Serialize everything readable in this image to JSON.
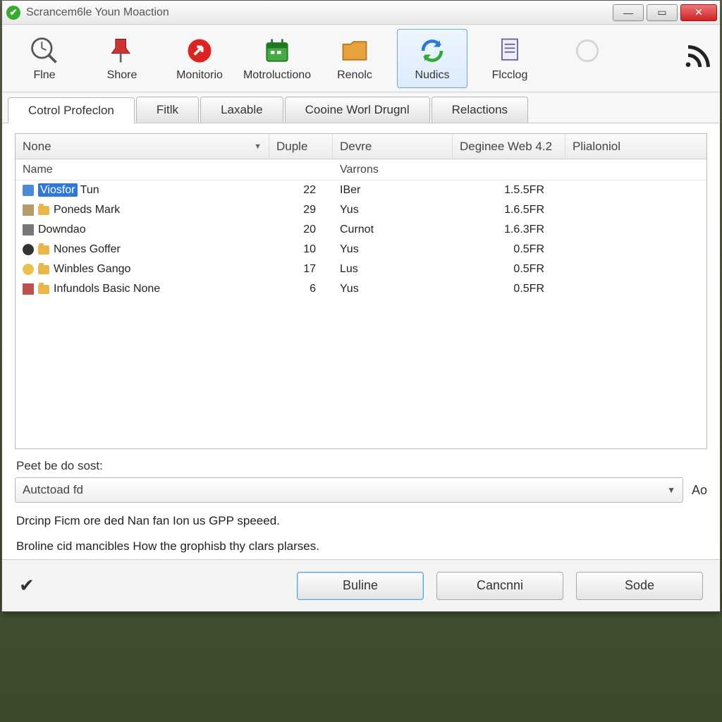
{
  "window": {
    "title": "Scrancem6le Youn Moaction"
  },
  "toolbar": {
    "items": [
      {
        "label": "Flne"
      },
      {
        "label": "Shore"
      },
      {
        "label": "Monitorio"
      },
      {
        "label": "Motroluctiono"
      },
      {
        "label": "Renolc"
      },
      {
        "label": "Nudics"
      },
      {
        "label": "Flcclog"
      }
    ]
  },
  "tabs": {
    "items": [
      {
        "label": "Cotrol Profeclon"
      },
      {
        "label": "Fitlk"
      },
      {
        "label": "Laxable"
      },
      {
        "label": "Cooine Worl Drugnl"
      },
      {
        "label": "Relactions"
      }
    ]
  },
  "grid": {
    "columns": [
      "None",
      "Duple",
      "Devre",
      "Deginee Web 4.2",
      "Plialoniol"
    ],
    "subheader": {
      "c1": "Name",
      "c3": "Varrons"
    },
    "rows": [
      {
        "name_sel": "Viosfor",
        "name_rest": " Tun",
        "duple": "22",
        "devre": "IBer",
        "deg": "1.5.5FR"
      },
      {
        "name": "Poneds Mark",
        "duple": "29",
        "devre": "Yus",
        "deg": "1.6.5FR",
        "folder": true
      },
      {
        "name": "Downdao",
        "duple": "20",
        "devre": "Curnot",
        "deg": "1.6.3FR"
      },
      {
        "name": "Nones Goffer",
        "duple": "10",
        "devre": "Yus",
        "deg": "0.5FR",
        "folder": true
      },
      {
        "name": "Winbles Gango",
        "duple": "17",
        "devre": "Lus",
        "deg": "0.5FR",
        "folder": true
      },
      {
        "name": "Infundols Basic None",
        "duple": "6",
        "devre": "Yus",
        "deg": "0.5FR",
        "folder": true
      }
    ]
  },
  "section": {
    "label": "Peet be do sost:",
    "combo_value": "Autctoad fd",
    "suffix": "Ao"
  },
  "paras": [
    "Drcinp Ficm ore ded Nan fan Ion us GPP speeed.",
    "Broline cid mancibles How the grophisb thy clars plarses."
  ],
  "footer": {
    "primary": "Buline",
    "cancel": "Cancnni",
    "save": "Sode"
  }
}
